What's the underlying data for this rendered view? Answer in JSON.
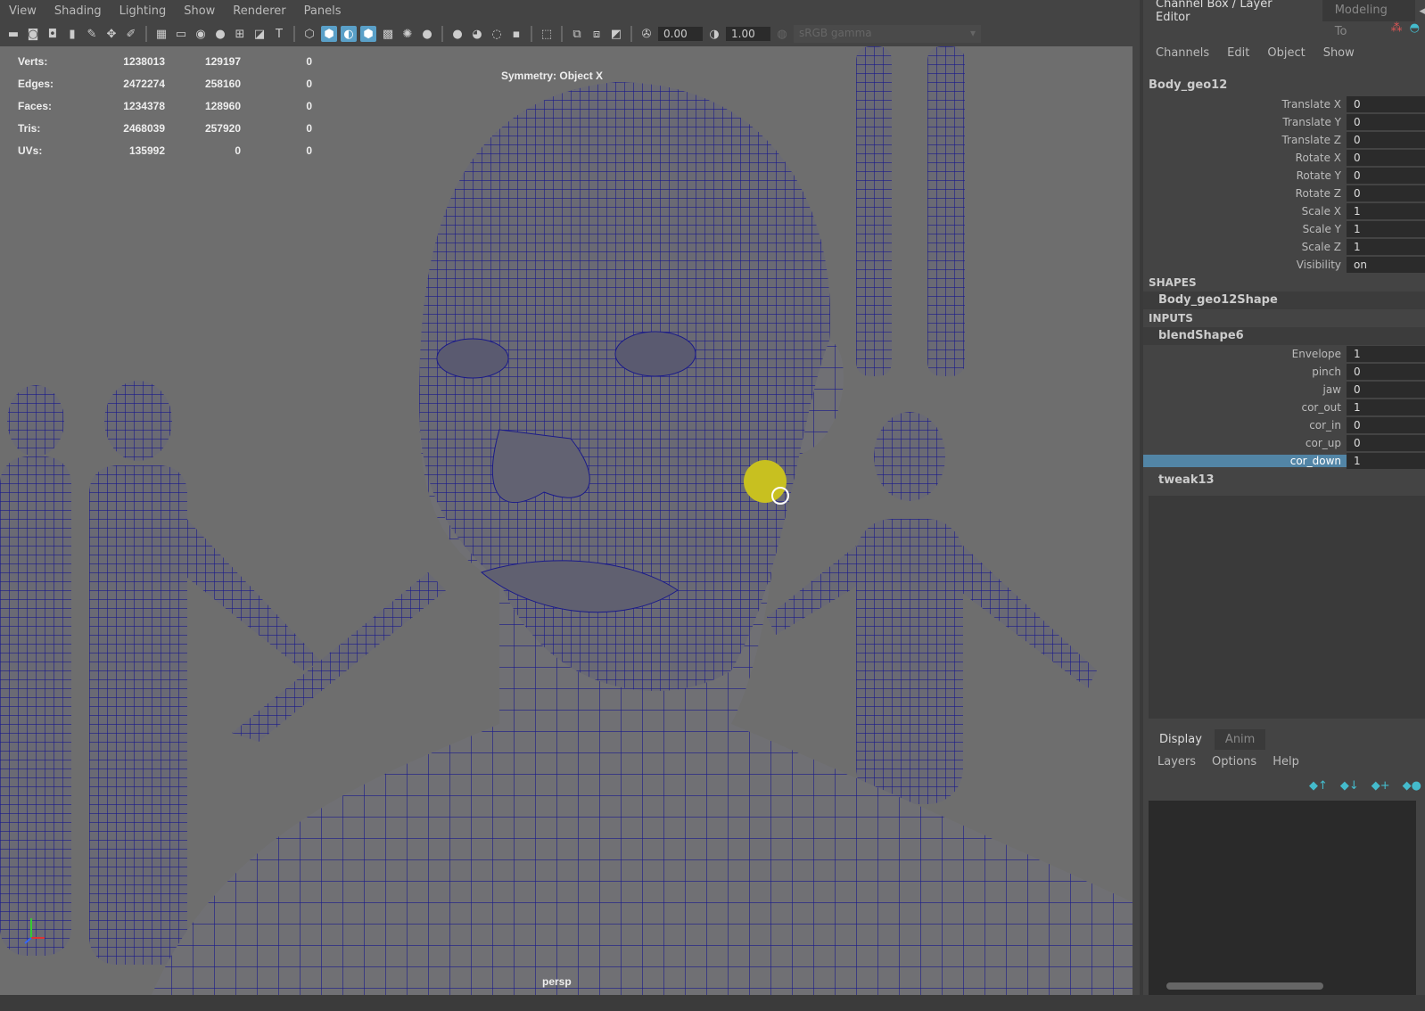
{
  "menubar": [
    "View",
    "Shading",
    "Lighting",
    "Show",
    "Renderer",
    "Panels"
  ],
  "toolbar": {
    "exposure": "0.00",
    "gamma": "1.00",
    "colorspace": "sRGB gamma"
  },
  "hud": {
    "rows": [
      {
        "label": "Verts:",
        "a": "1238013",
        "b": "129197",
        "c": "0"
      },
      {
        "label": "Edges:",
        "a": "2472274",
        "b": "258160",
        "c": "0"
      },
      {
        "label": "Faces:",
        "a": "1234378",
        "b": "128960",
        "c": "0"
      },
      {
        "label": "Tris:",
        "a": "2468039",
        "b": "257920",
        "c": "0"
      },
      {
        "label": "UVs:",
        "a": "135992",
        "b": "0",
        "c": "0"
      }
    ],
    "symmetry": "Symmetry: Object X",
    "camera": "persp"
  },
  "panel": {
    "tabs": [
      "Channel Box / Layer Editor",
      "Modeling To"
    ],
    "menu": [
      "Channels",
      "Edit",
      "Object",
      "Show"
    ],
    "object": "Body_geo12",
    "channels": [
      {
        "n": "Translate X",
        "v": "0"
      },
      {
        "n": "Translate Y",
        "v": "0"
      },
      {
        "n": "Translate Z",
        "v": "0"
      },
      {
        "n": "Rotate X",
        "v": "0"
      },
      {
        "n": "Rotate Y",
        "v": "0"
      },
      {
        "n": "Rotate Z",
        "v": "0"
      },
      {
        "n": "Scale X",
        "v": "1"
      },
      {
        "n": "Scale Y",
        "v": "1"
      },
      {
        "n": "Scale Z",
        "v": "1"
      },
      {
        "n": "Visibility",
        "v": "on"
      }
    ],
    "shapes_label": "SHAPES",
    "shape": "Body_geo12Shape",
    "inputs_label": "INPUTS",
    "input": "blendShape6",
    "blend": [
      {
        "n": "Envelope",
        "v": "1"
      },
      {
        "n": "pinch",
        "v": "0"
      },
      {
        "n": "jaw",
        "v": "0"
      },
      {
        "n": "cor_out",
        "v": "1"
      },
      {
        "n": "cor_in",
        "v": "0"
      },
      {
        "n": "cor_up",
        "v": "0"
      },
      {
        "n": "cor_down",
        "v": "1"
      }
    ],
    "tweak": "tweak13"
  },
  "layers": {
    "tabs": [
      "Display",
      "Anim"
    ],
    "menu": [
      "Layers",
      "Options",
      "Help"
    ]
  },
  "colors": {
    "wire": "#1a1a8a",
    "selection": "#5285a6",
    "accent": "#5aa0c8"
  }
}
